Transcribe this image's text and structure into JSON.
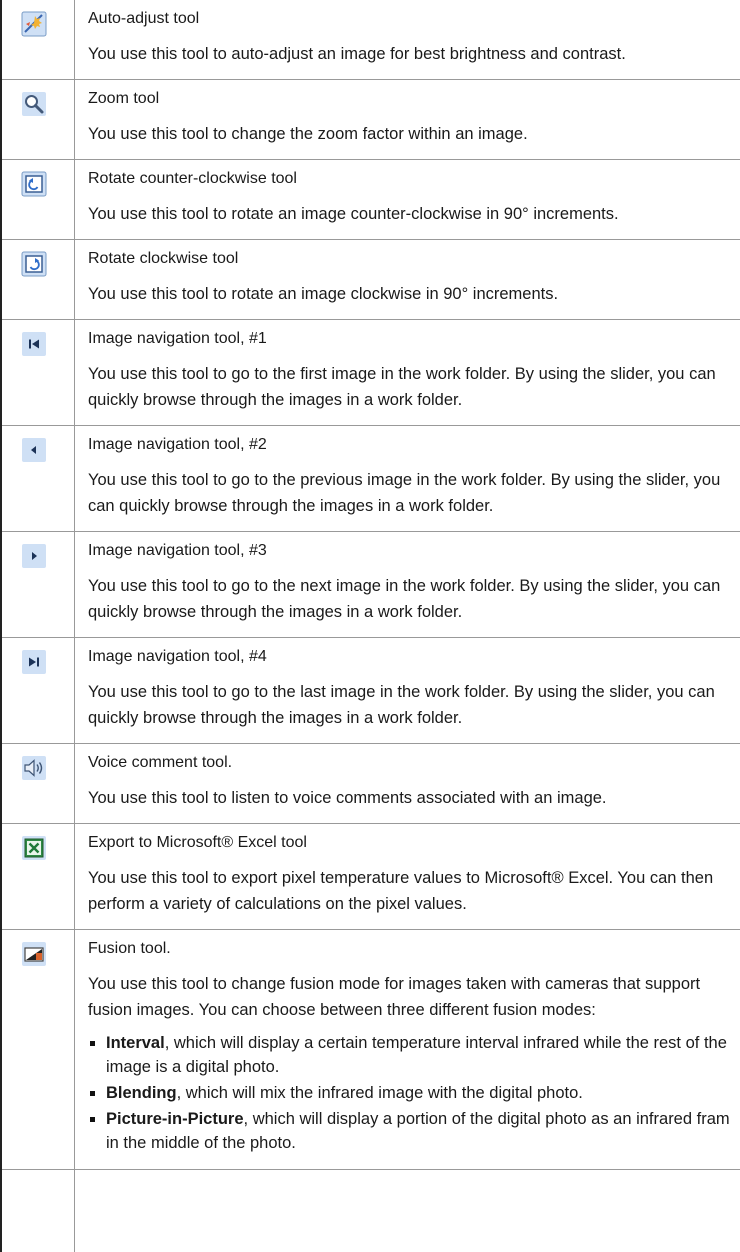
{
  "tools": [
    {
      "icon": "auto-adjust-icon",
      "title": "Auto-adjust tool",
      "desc": "You use this tool to auto-adjust an image for best brightness and contrast."
    },
    {
      "icon": "magnifier-icon",
      "title": "Zoom tool",
      "desc": "You use this tool to change the zoom factor within an image."
    },
    {
      "icon": "rotate-ccw-icon",
      "title": "Rotate counter-clockwise tool",
      "desc": "You use this tool to rotate an image counter-clockwise in 90° increments."
    },
    {
      "icon": "rotate-cw-icon",
      "title": "Rotate clockwise tool",
      "desc": "You use this tool to rotate an image clockwise in 90° increments."
    },
    {
      "icon": "first-image-icon",
      "title": "Image navigation tool, #1",
      "desc": "You use this tool to go to the first image in the work folder. By using the slider, you can quickly browse through the images in a work folder."
    },
    {
      "icon": "previous-image-icon",
      "title": "Image navigation tool, #2",
      "desc": "You use this tool to go to the previous image in the work folder. By using the slider, you can quickly browse through the images in a work folder."
    },
    {
      "icon": "next-image-icon",
      "title": "Image navigation tool, #3",
      "desc": "You use this tool to go to the next image in the work folder. By using the slider, you can quickly browse through the images in a work folder."
    },
    {
      "icon": "last-image-icon",
      "title": "Image navigation tool, #4",
      "desc": "You use this tool to go to the last image in the work folder. By using the slider, you can quickly browse through the images in a work folder."
    },
    {
      "icon": "speaker-icon",
      "title": "Voice comment tool.",
      "desc": "You use this tool to listen to voice comments associated with an image."
    },
    {
      "icon": "excel-icon",
      "title": "Export to Microsoft® Excel tool",
      "desc": "You use this tool to export pixel temperature values to Microsoft® Excel. You can then perform a variety of calculations on the pixel values."
    },
    {
      "icon": "fusion-icon",
      "title": "Fusion tool.",
      "desc": "You use this tool to change fusion mode for images taken with cameras that support fusion images. You can choose between three different fusion modes:",
      "modes": [
        {
          "name": "Interval",
          "text": ", which will display a certain temperature interval infrared while the rest of the image is a digital photo."
        },
        {
          "name": "Blending",
          "text": ", which will mix the infrared image with the digital photo."
        },
        {
          "name": "Picture-in-Picture",
          "text": ", which will display a portion of the digital photo as an infrared fram in the middle of the photo."
        }
      ]
    }
  ]
}
